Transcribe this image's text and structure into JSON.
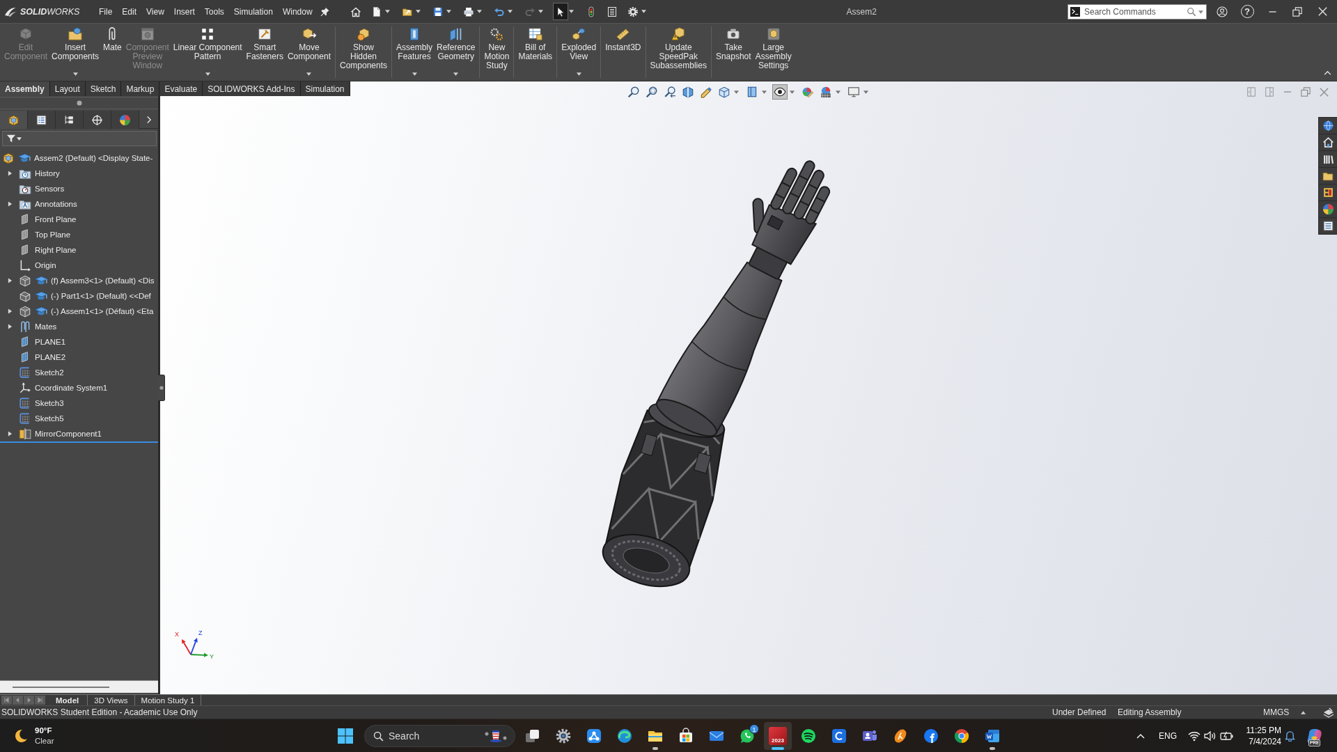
{
  "title_bar": {
    "logo": "**SOLID**WORKS",
    "menus": [
      "File",
      "Edit",
      "View",
      "Insert",
      "Tools",
      "Simulation",
      "Window"
    ],
    "quick_access": [
      {
        "kind": "home",
        "dropdown": false,
        "disabled": false,
        "selected": false
      },
      {
        "kind": "new",
        "dropdown": true,
        "disabled": false,
        "selected": false
      },
      {
        "kind": "open",
        "dropdown": true,
        "disabled": false,
        "selected": false
      },
      {
        "kind": "save",
        "dropdown": true,
        "disabled": false,
        "selected": false
      },
      {
        "kind": "print",
        "dropdown": true,
        "disabled": false,
        "selected": false
      },
      {
        "kind": "undo",
        "dropdown": true,
        "disabled": false,
        "selected": false
      },
      {
        "kind": "redo",
        "dropdown": true,
        "disabled": true,
        "selected": false
      },
      {
        "kind": "select",
        "dropdown": true,
        "disabled": false,
        "selected": true
      },
      {
        "kind": "rebuild",
        "dropdown": false,
        "disabled": false,
        "selected": false
      },
      {
        "kind": "file-properties",
        "dropdown": false,
        "disabled": false,
        "selected": false
      },
      {
        "kind": "options",
        "dropdown": true,
        "disabled": false,
        "selected": false
      }
    ],
    "document_title": "Assem2",
    "search": {
      "placeholder": "Search Commands"
    },
    "window_controls": [
      {
        "kind": "account"
      },
      {
        "kind": "help",
        "label": "?"
      },
      {
        "kind": "minimize"
      },
      {
        "kind": "restore"
      },
      {
        "kind": "close"
      }
    ]
  },
  "command_manager": {
    "groups": [
      {
        "commands": [
          {
            "kind": "edit-component",
            "lines": [
              "Edit",
              "Component"
            ],
            "disabled": true,
            "dropdown": false
          },
          {
            "kind": "insert-components",
            "lines": [
              "Insert",
              "Components"
            ],
            "disabled": false,
            "dropdown": true
          },
          {
            "kind": "mate",
            "lines": [
              "Mate"
            ],
            "disabled": false,
            "dropdown": false
          },
          {
            "kind": "component-preview",
            "lines": [
              "Component",
              "Preview",
              "Window"
            ],
            "disabled": true,
            "dropdown": false
          },
          {
            "kind": "linear-pattern",
            "lines": [
              "Linear Component",
              "Pattern"
            ],
            "disabled": false,
            "dropdown": true
          },
          {
            "kind": "smart-fasteners",
            "lines": [
              "Smart",
              "Fasteners"
            ],
            "disabled": false,
            "dropdown": false
          },
          {
            "kind": "move-component",
            "lines": [
              "Move",
              "Component"
            ],
            "disabled": false,
            "dropdown": true
          }
        ]
      },
      {
        "commands": [
          {
            "kind": "show-hidden",
            "lines": [
              "Show",
              "Hidden",
              "Components"
            ],
            "disabled": false,
            "dropdown": false
          }
        ]
      },
      {
        "commands": [
          {
            "kind": "assembly-features",
            "lines": [
              "Assembly",
              "Features"
            ],
            "disabled": false,
            "dropdown": true
          },
          {
            "kind": "reference-geometry",
            "lines": [
              "Reference",
              "Geometry"
            ],
            "disabled": false,
            "dropdown": true
          }
        ]
      },
      {
        "commands": [
          {
            "kind": "motion-study",
            "lines": [
              "New",
              "Motion",
              "Study"
            ],
            "disabled": false,
            "dropdown": false
          }
        ]
      },
      {
        "commands": [
          {
            "kind": "bill-of-materials",
            "lines": [
              "Bill of",
              "Materials"
            ],
            "disabled": false,
            "dropdown": false
          }
        ]
      },
      {
        "commands": [
          {
            "kind": "exploded-view",
            "lines": [
              "Exploded",
              "View"
            ],
            "disabled": false,
            "dropdown": true
          }
        ]
      },
      {
        "commands": [
          {
            "kind": "instant3d",
            "lines": [
              "Instant3D"
            ],
            "disabled": false,
            "dropdown": false
          }
        ]
      },
      {
        "commands": [
          {
            "kind": "speedpak",
            "lines": [
              "Update",
              "SpeedPak",
              "Subassemblies"
            ],
            "disabled": false,
            "dropdown": false
          }
        ]
      },
      {
        "commands": [
          {
            "kind": "snapshot",
            "lines": [
              "Take",
              "Snapshot"
            ],
            "disabled": false,
            "dropdown": false
          },
          {
            "kind": "large-assembly",
            "lines": [
              "Large",
              "Assembly",
              "Settings"
            ],
            "disabled": false,
            "dropdown": false
          }
        ]
      }
    ]
  },
  "tabs": [
    {
      "label": "Assembly",
      "selected": true
    },
    {
      "label": "Layout",
      "selected": false
    },
    {
      "label": "Sketch",
      "selected": false
    },
    {
      "label": "Markup",
      "selected": false
    },
    {
      "label": "Evaluate",
      "selected": false
    },
    {
      "label": "SOLIDWORKS Add-Ins",
      "selected": false
    },
    {
      "label": "Simulation",
      "selected": false
    }
  ],
  "feature_manager": {
    "panel_tabs": [
      {
        "kind": "feature-tree",
        "selected": true
      },
      {
        "kind": "property-manager",
        "selected": false
      },
      {
        "kind": "configuration-manager",
        "selected": false
      },
      {
        "kind": "dimxpert",
        "selected": false
      },
      {
        "kind": "display-manager",
        "selected": false
      }
    ],
    "tree": [
      {
        "label": "Assem2 (Default) <Display State-",
        "kind": "assembly",
        "expandable": false,
        "children": [
          {
            "label": "History",
            "kind": "history",
            "expandable": true
          },
          {
            "label": "Sensors",
            "kind": "sensors",
            "expandable": false
          },
          {
            "label": "Annotations",
            "kind": "annotations",
            "expandable": true
          },
          {
            "label": "Front Plane",
            "kind": "plane",
            "expandable": false
          },
          {
            "label": "Top Plane",
            "kind": "plane",
            "expandable": false
          },
          {
            "label": "Right Plane",
            "kind": "plane",
            "expandable": false
          },
          {
            "label": "Origin",
            "kind": "origin",
            "expandable": false
          },
          {
            "label": "(f) Assem3<1> (Default) <Dis",
            "kind": "subassembly",
            "expandable": true
          },
          {
            "label": "(-) Part1<1> (Default) <<Def",
            "kind": "part",
            "expandable": false
          },
          {
            "label": "(-) Assem1<1> (Défaut) <Eta",
            "kind": "subassembly",
            "expandable": true
          },
          {
            "label": "Mates",
            "kind": "mates",
            "expandable": true
          },
          {
            "label": "PLANE1",
            "kind": "ref-plane",
            "expandable": false
          },
          {
            "label": "PLANE2",
            "kind": "ref-plane",
            "expandable": false
          },
          {
            "label": "Sketch2",
            "kind": "sketch",
            "expandable": false
          },
          {
            "label": "Coordinate System1",
            "kind": "coordinate-system",
            "expandable": false
          },
          {
            "label": "Sketch3",
            "kind": "sketch",
            "expandable": false
          },
          {
            "label": "Sketch5",
            "kind": "sketch",
            "expandable": false
          },
          {
            "label": "MirrorComponent1",
            "kind": "mirror",
            "expandable": true
          }
        ]
      }
    ]
  },
  "viewport": {
    "view_toolbar": [
      {
        "kind": "zoom-to-fit",
        "dropdown": false,
        "selected": false
      },
      {
        "kind": "zoom-to-area",
        "dropdown": false,
        "selected": false
      },
      {
        "kind": "previous-view",
        "dropdown": false,
        "selected": false
      },
      {
        "kind": "section-view",
        "dropdown": false,
        "selected": false
      },
      {
        "kind": "dynamic-annotation",
        "dropdown": false,
        "selected": false
      },
      {
        "kind": "view-orientation",
        "dropdown": true,
        "selected": false
      },
      {
        "kind": "display-style",
        "dropdown": true,
        "selected": false
      },
      {
        "kind": "hide-show-items",
        "dropdown": true,
        "selected": true
      },
      {
        "kind": "edit-appearance",
        "dropdown": false,
        "selected": false
      },
      {
        "kind": "apply-scene",
        "dropdown": true,
        "selected": false
      },
      {
        "kind": "view-settings",
        "dropdown": true,
        "selected": false
      }
    ],
    "window_controls": [
      {
        "kind": "tile-left"
      },
      {
        "kind": "tile-right"
      },
      {
        "kind": "minimize"
      },
      {
        "kind": "restore"
      },
      {
        "kind": "close"
      }
    ],
    "task_pane": [
      {
        "kind": "resources"
      },
      {
        "kind": "design-library"
      },
      {
        "kind": "file-explorer"
      },
      {
        "kind": "view-palette"
      },
      {
        "kind": "appearances"
      },
      {
        "kind": "color"
      },
      {
        "kind": "custom-properties"
      }
    ],
    "triad": [
      {
        "label": "X",
        "color": "#e02020"
      },
      {
        "label": "Y",
        "color": "#1a9a2a"
      },
      {
        "label": "Z",
        "color": "#2040e0"
      }
    ]
  },
  "bottom_tabs": [
    {
      "label": "Model",
      "selected": true
    },
    {
      "label": "3D Views",
      "selected": false
    },
    {
      "label": "Motion Study 1",
      "selected": false
    }
  ],
  "status_bar": {
    "message": "SOLIDWORKS Student Edition - Academic Use Only",
    "fields": [
      "Under Defined",
      "Editing Assembly",
      "MMGS"
    ]
  },
  "taskbar": {
    "weather": {
      "temperature": "90°F",
      "condition": "Clear"
    },
    "search": {
      "placeholder": "Search"
    },
    "apps": [
      {
        "kind": "start",
        "running": false,
        "active": false
      },
      {
        "kind": "task-view",
        "running": false,
        "active": false
      },
      {
        "kind": "settings",
        "running": false,
        "active": false
      },
      {
        "kind": "share",
        "running": false,
        "active": false
      },
      {
        "kind": "browser",
        "running": false,
        "active": false
      },
      {
        "kind": "files",
        "running": true,
        "active": false
      },
      {
        "kind": "store",
        "running": false,
        "active": false
      },
      {
        "kind": "mail",
        "running": false,
        "active": false
      },
      {
        "kind": "messenger",
        "running": false,
        "active": false,
        "badge": "1"
      },
      {
        "kind": "cad",
        "running": true,
        "active": true,
        "label": "2023"
      },
      {
        "kind": "music",
        "running": false,
        "active": false
      },
      {
        "kind": "c-app",
        "running": false,
        "active": false
      },
      {
        "kind": "meetings",
        "running": false,
        "active": false
      },
      {
        "kind": "k-app",
        "running": false,
        "active": false
      },
      {
        "kind": "social",
        "running": false,
        "active": false
      },
      {
        "kind": "web",
        "running": false,
        "active": false
      },
      {
        "kind": "writer",
        "running": true,
        "active": false
      }
    ],
    "tray": {
      "language": "ENG",
      "time": "11:25 PM",
      "date": "7/4/2024",
      "assistant_tag": "PRE"
    }
  }
}
